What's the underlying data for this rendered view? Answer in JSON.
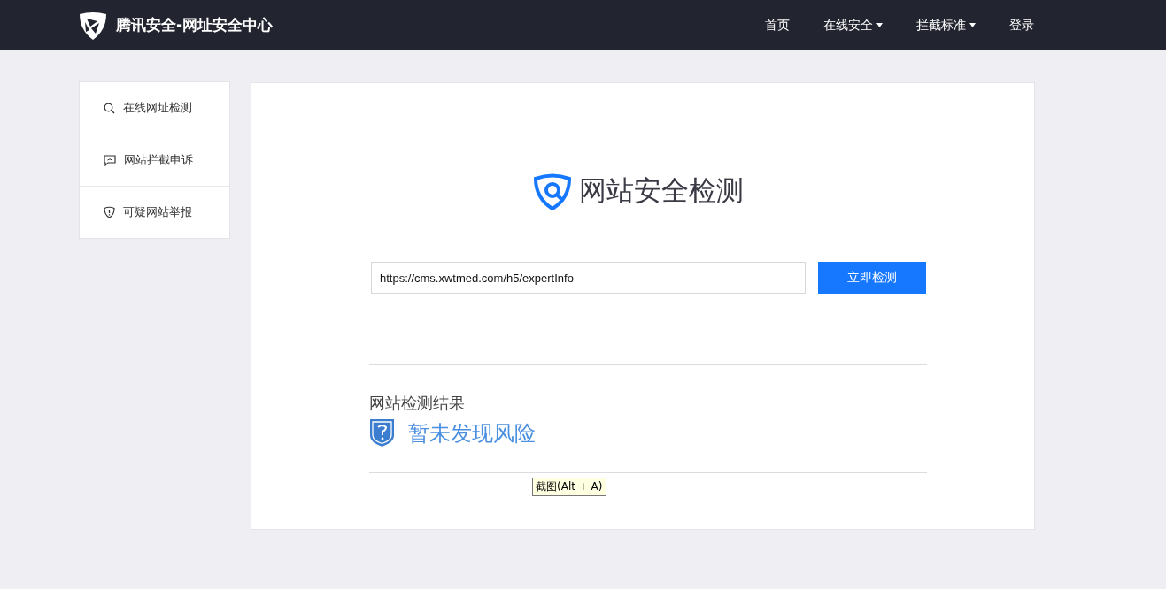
{
  "header": {
    "brand": "腾讯安全-网址安全中心",
    "nav": [
      {
        "label": "首页",
        "dropdown": false
      },
      {
        "label": "在线安全",
        "dropdown": true
      },
      {
        "label": "拦截标准",
        "dropdown": true
      },
      {
        "label": "登录",
        "dropdown": false
      }
    ]
  },
  "sidebar": {
    "items": [
      {
        "label": "在线网址检测",
        "kind": "search"
      },
      {
        "label": "网站拦截申诉",
        "kind": "appeal"
      },
      {
        "label": "可疑网站举报",
        "kind": "report"
      }
    ]
  },
  "main": {
    "title": "网站安全检测",
    "url_field": {
      "value": "https://cms.xwtmed.com/h5/expertInfo"
    },
    "check_button": "立即检测",
    "result": {
      "heading": "网站检测结果",
      "status": "暂未发现风险"
    },
    "tooltip": "截图(Alt + A)"
  }
}
